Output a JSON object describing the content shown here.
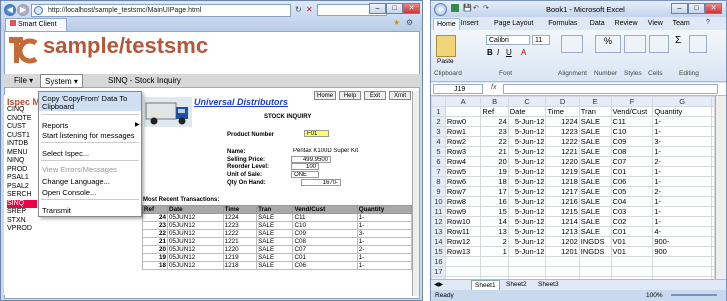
{
  "browser": {
    "url": "http://localhost/sample_testsmc/MainUIPage.html",
    "tab_label": "Smart Client",
    "app_title": "sample/testsmc",
    "menu": {
      "file": "File",
      "system": "System",
      "inquiry": "SINQ - Stock Inquiry"
    },
    "sidebar_title": "Ispec M",
    "sidebar_items": [
      "CINQ",
      "CNOTE",
      "CUST",
      "CUST1",
      "INTDB",
      "MENU",
      "NINQ",
      "PROD",
      "PSAL1",
      "PSAL2",
      "SERCH",
      "SINQ",
      "SREP",
      "STXN",
      "VPROD"
    ],
    "dropdown": {
      "items": [
        "Copy 'CopyFrom' Data To",
        "Clipboard",
        "Reports",
        "Start listening for messages",
        "Select Ispec...",
        "View Errors/Messages",
        "Change Language...",
        "Open Console...",
        "Transmit"
      ]
    },
    "form": {
      "buttons": [
        "Home",
        "Help",
        "Exit",
        "Xmit"
      ],
      "company": "Universal Distributors",
      "heading": "STOCK INQUIRY",
      "product_label": "Product Number",
      "product_value": "F01",
      "name_label": "Name:",
      "name_value": "Pentax K100D Super Kit",
      "selling_label": "Selling Price:",
      "selling_value": "499.9500",
      "reorder_label": "Reorder Level:",
      "reorder_value": "100",
      "unit_label": "Unit of Sale:",
      "unit_value": "ONE",
      "qty_label": "Qty On Hand:",
      "qty_value": "1670-",
      "recent_label": "Most Recent Transactions:",
      "columns": [
        "Ref",
        "Date",
        "Time",
        "Tran",
        "Vend/Cust",
        "Quantity"
      ],
      "rows": [
        [
          "24",
          "05JUN12",
          "1224",
          "SALE",
          "C11",
          "1-"
        ],
        [
          "23",
          "05JUN12",
          "1223",
          "SALE",
          "C10",
          "1-"
        ],
        [
          "22",
          "05JUN12",
          "1222",
          "SALE",
          "C09",
          "3-"
        ],
        [
          "21",
          "05JUN12",
          "1221",
          "SALE",
          "C08",
          "1-"
        ],
        [
          "20",
          "05JUN12",
          "1220",
          "SALE",
          "C07",
          "2-"
        ],
        [
          "19",
          "05JUN12",
          "1219",
          "SALE",
          "C01",
          "1-"
        ],
        [
          "18",
          "05JUN12",
          "1218",
          "SALE",
          "C06",
          "1-"
        ]
      ]
    }
  },
  "excel": {
    "title": "Book1 - Microsoft Excel",
    "tabs": [
      "Home",
      "Insert",
      "Page Layout",
      "Formulas",
      "Data",
      "Review",
      "View",
      "Team"
    ],
    "font_name": "Calibri",
    "font_size": "11",
    "groups": [
      "Clipboard",
      "Font",
      "Alignment",
      "Number",
      "Styles",
      "Cells",
      "Editing"
    ],
    "paste_label": "Paste",
    "name_box": "J19",
    "fx": "fx",
    "columns": [
      "A",
      "B",
      "C",
      "D",
      "E",
      "F",
      "G"
    ],
    "header_row": [
      "",
      "Ref",
      "Date",
      "Time",
      "Tran",
      "Vend/Cust",
      "Quantity"
    ],
    "rows": [
      [
        "Row0",
        "24",
        "5-Jun-12",
        "1224",
        "SALE",
        "C11",
        "1-"
      ],
      [
        "Row1",
        "23",
        "5-Jun-12",
        "1223",
        "SALE",
        "C10",
        "1-"
      ],
      [
        "Row2",
        "22",
        "5-Jun-12",
        "1222",
        "SALE",
        "C09",
        "3-"
      ],
      [
        "Row3",
        "21",
        "5-Jun-12",
        "1221",
        "SALE",
        "C08",
        "1-"
      ],
      [
        "Row4",
        "20",
        "5-Jun-12",
        "1220",
        "SALE",
        "C07",
        "2-"
      ],
      [
        "Row5",
        "19",
        "5-Jun-12",
        "1219",
        "SALE",
        "C01",
        "1-"
      ],
      [
        "Row6",
        "18",
        "5-Jun-12",
        "1218",
        "SALE",
        "C06",
        "1-"
      ],
      [
        "Row7",
        "17",
        "5-Jun-12",
        "1217",
        "SALE",
        "C05",
        "2-"
      ],
      [
        "Row8",
        "16",
        "5-Jun-12",
        "1216",
        "SALE",
        "C04",
        "1-"
      ],
      [
        "Row9",
        "15",
        "5-Jun-12",
        "1215",
        "SALE",
        "C03",
        "1-"
      ],
      [
        "Row10",
        "14",
        "5-Jun-12",
        "1214",
        "SALE",
        "C02",
        "1-"
      ],
      [
        "Row11",
        "13",
        "5-Jun-12",
        "1213",
        "SALE",
        "C01",
        "4-"
      ],
      [
        "Row12",
        "2",
        "5-Jun-12",
        "1202",
        "INGDS",
        "V01",
        "900-"
      ],
      [
        "Row13",
        "1",
        "5-Jun-12",
        "1201",
        "INGDS",
        "V01",
        "900"
      ]
    ],
    "sheet_tabs": [
      "Sheet1",
      "Sheet2",
      "Sheet3"
    ],
    "status": "Ready",
    "zoom": "100%"
  }
}
